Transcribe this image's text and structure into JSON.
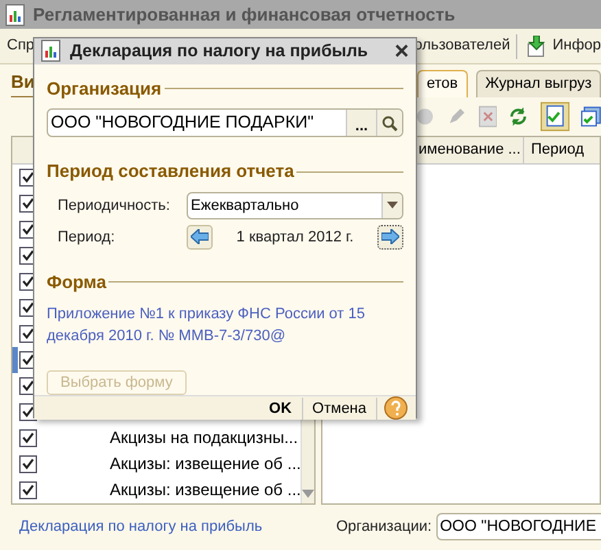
{
  "window": {
    "title": "Регламентированная и финансовая отчетность"
  },
  "toolbar": {
    "items": [
      "Спр",
      "ользователей",
      "Инфор"
    ]
  },
  "left_panel": {
    "heading": "Ви"
  },
  "tabs": [
    {
      "label": "етов",
      "selected": true
    },
    {
      "label": "Журнал выгруз",
      "selected": false
    }
  ],
  "columns": [
    "именование ...",
    "Период"
  ],
  "reports": [
    {
      "checked": true,
      "selected": false
    },
    {
      "checked": true,
      "selected": false
    },
    {
      "checked": true,
      "selected": false
    },
    {
      "checked": true,
      "selected": false
    },
    {
      "checked": true,
      "selected": false
    },
    {
      "checked": true,
      "selected": false
    },
    {
      "checked": true,
      "selected": false
    },
    {
      "checked": true,
      "selected": true
    },
    {
      "checked": true,
      "selected": false
    },
    {
      "checked": true,
      "selected": false
    },
    {
      "checked": true,
      "selected": false,
      "name": "Акцизы на подакцизны..."
    },
    {
      "checked": true,
      "selected": false,
      "name": "Акцизы: извещение об ..."
    },
    {
      "checked": true,
      "selected": false,
      "name": "Акцизы: извещение об ..."
    }
  ],
  "footer_link": "Декларация по налогу на прибыль",
  "organizations": {
    "label": "Организации:",
    "value": "ООО \"НОВОГОДНИЕ"
  },
  "dialog": {
    "title": "Декларация по налогу на прибыль",
    "close": "×",
    "organization": {
      "heading": "Организация",
      "value": "ООО \"НОВОГОДНИЕ ПОДАРКИ\"",
      "select_button": "..."
    },
    "period": {
      "heading": "Период составления отчета",
      "frequency_label": "Периодичность:",
      "frequency": "Ежеквартально",
      "period_label": "Период:",
      "period": "1 квартал 2012 г."
    },
    "form": {
      "heading": "Форма",
      "description": "Приложение №1 к приказу ФНС России от 15 декабря 2010 г. № ММВ-7-3/730@",
      "choose_button": {
        "label": "Выбрать форму",
        "disabled": true
      }
    },
    "buttons": [
      {
        "label": "OK",
        "default": true
      },
      {
        "label": "Отмена",
        "default": false
      }
    ]
  }
}
